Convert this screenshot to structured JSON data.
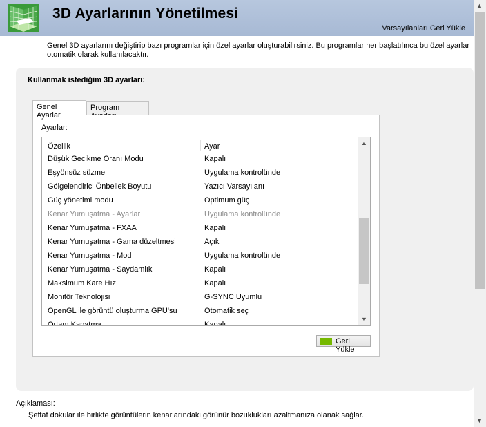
{
  "header": {
    "title": "3D Ayarlarının Yönetilmesi",
    "restore_defaults": "Varsayılanları Geri Yükle"
  },
  "intro": "Genel 3D ayarlarını değiştirip bazı programlar için özel ayarlar oluşturabilirsiniz. Bu programlar her başlatılınca bu özel ayarlar otomatik olarak kullanılacaktır.",
  "panel": {
    "title": "Kullanmak istediğim 3D ayarları:",
    "tabs": [
      "Genel Ayarlar",
      "Program Ayarları"
    ],
    "settings_label": "Ayarlar:",
    "columns": [
      "Özellik",
      "Ayar"
    ],
    "rows": [
      {
        "feature": "Düşük Gecikme Oranı Modu",
        "value": "Kapalı"
      },
      {
        "feature": "Eşyönsüz süzme",
        "value": "Uygulama kontrolünde"
      },
      {
        "feature": "Gölgelendirici Önbellek Boyutu",
        "value": "Yazıcı Varsayılanı"
      },
      {
        "feature": "Güç yönetimi modu",
        "value": "Optimum güç"
      },
      {
        "feature": "Kenar Yumuşatma - Ayarlar",
        "value": "Uygulama kontrolünde",
        "disabled": true
      },
      {
        "feature": "Kenar Yumuşatma - FXAA",
        "value": "Kapalı"
      },
      {
        "feature": "Kenar Yumuşatma - Gama düzeltmesi",
        "value": "Açık"
      },
      {
        "feature": "Kenar Yumuşatma - Mod",
        "value": "Uygulama kontrolünde"
      },
      {
        "feature": "Kenar Yumuşatma - Saydamlık",
        "value": "Kapalı"
      },
      {
        "feature": "Maksimum Kare Hızı",
        "value": "Kapalı"
      },
      {
        "feature": "Monitör Teknolojisi",
        "value": "G-SYNC Uyumlu"
      },
      {
        "feature": "OpenGL ile görüntü oluşturma GPU'su",
        "value": "Otomatik seç"
      },
      {
        "feature": "Ortam Kapatma",
        "value": "Kapalı"
      }
    ],
    "restore_button": "Geri Yükle"
  },
  "description": {
    "label": "Açıklaması:",
    "text": "Şeffaf dokular ile birlikte görüntülerin kenarlarındaki görünür bozuklukları azaltmanıza olanak sağlar."
  }
}
